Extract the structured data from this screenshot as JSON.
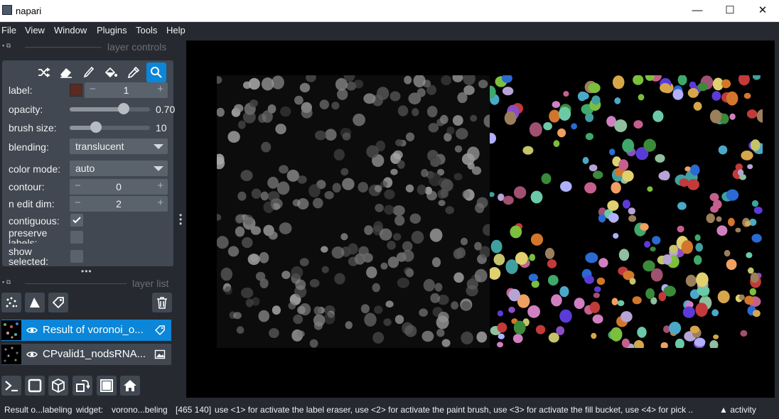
{
  "window": {
    "title": "napari",
    "minimize_glyph": "—",
    "maximize_glyph": "☐",
    "close_glyph": "✕"
  },
  "menu": [
    "File",
    "View",
    "Window",
    "Plugins",
    "Tools",
    "Help"
  ],
  "layer_controls": {
    "title": "layer controls",
    "label": {
      "label": "label:",
      "value": "1",
      "swatch_color": "#5c2a22"
    },
    "opacity": {
      "label": "opacity:",
      "value": "0.70",
      "fraction": 0.7
    },
    "brush_size": {
      "label": "brush size:",
      "value": "10",
      "fraction": 0.3
    },
    "blending": {
      "label": "blending:",
      "value": "translucent"
    },
    "color_mode": {
      "label": "color mode:",
      "value": "auto"
    },
    "contour": {
      "label": "contour:",
      "value": "0"
    },
    "n_edit_dim": {
      "label": "n edit dim:",
      "value": "2"
    },
    "contiguous": {
      "label": "contiguous:",
      "checked": true
    },
    "preserve_labels": {
      "label": "preserve labels:",
      "checked": false
    },
    "show_selected": {
      "label": "show selected:",
      "checked": false
    },
    "tools": [
      "shuffle-icon",
      "eraser-icon",
      "paint-brush-icon",
      "fill-bucket-icon",
      "color-picker-icon",
      "zoom-icon"
    ],
    "active_tool": "zoom-icon"
  },
  "layer_list": {
    "title": "layer list",
    "layers": [
      {
        "name": "Result of voronoi_o...",
        "type": "labels",
        "selected": true
      },
      {
        "name": "CPvalid1_nodsRNA...",
        "type": "image",
        "selected": false
      }
    ]
  },
  "status": {
    "layer": "Result o...labeling",
    "widget_label": "widget:",
    "widget": "vorono...beling",
    "coords": "[465 140]",
    "message": "use <1> for activate the label eraser, use <2> for activate the paint brush, use <3> for activate the fill bucket, use <4> for pick ...",
    "activity": "activity"
  },
  "colors": {
    "accent": "#0b86d8",
    "panel": "#414851",
    "background": "#262930"
  }
}
